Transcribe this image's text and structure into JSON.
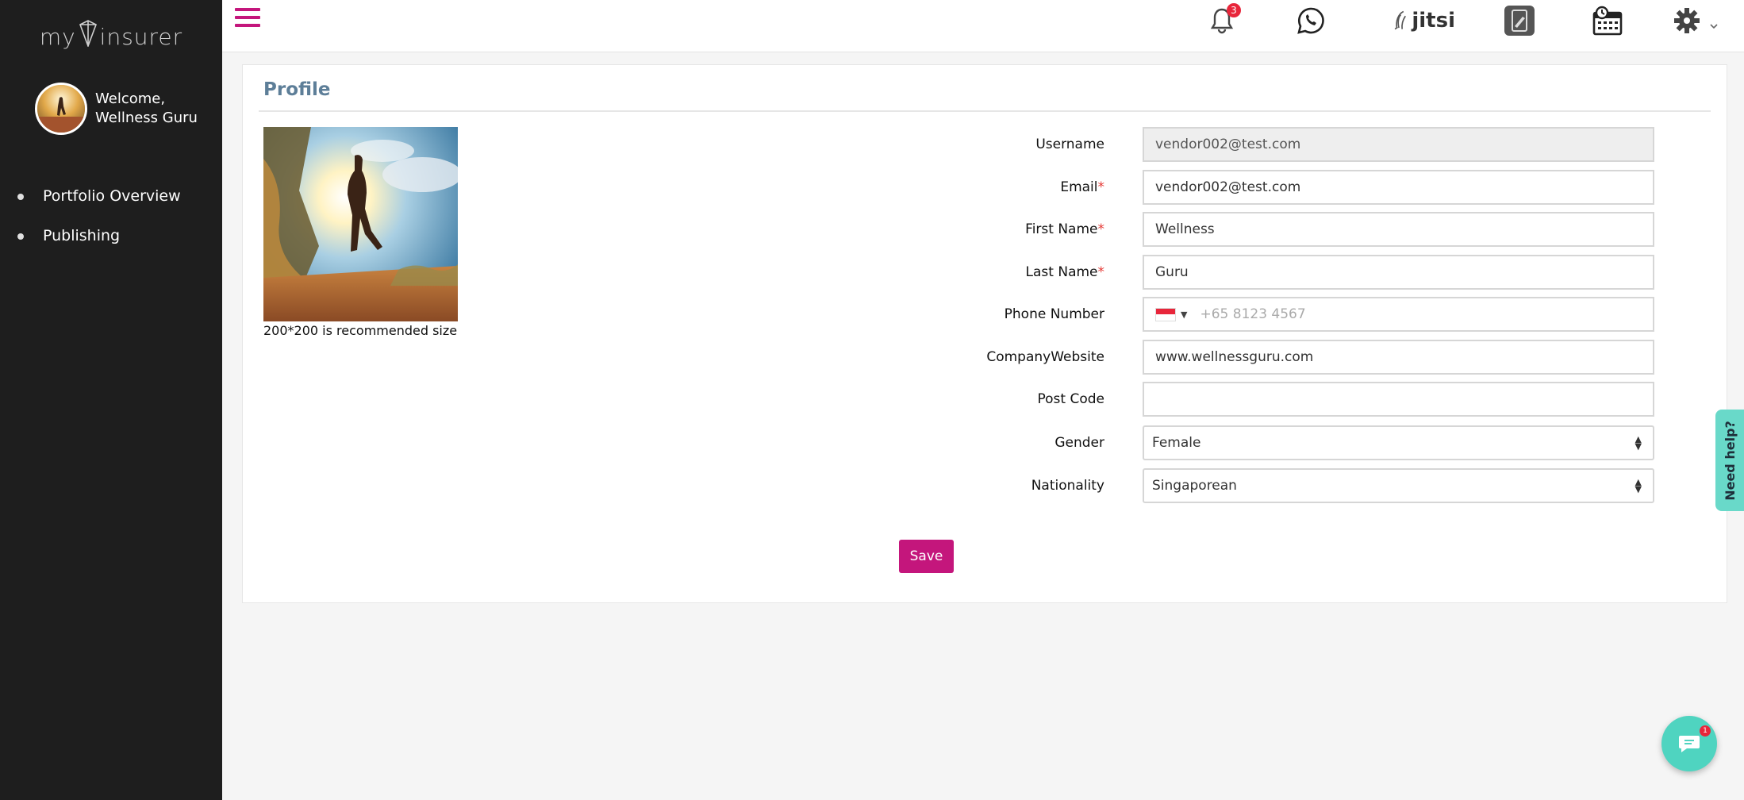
{
  "brand": {
    "logo_left": "my",
    "logo_right": "insurer"
  },
  "user": {
    "welcome": "Welcome,",
    "name": "Wellness Guru"
  },
  "sidebar": {
    "items": [
      {
        "label": "Portfolio Overview"
      },
      {
        "label": "Publishing"
      }
    ]
  },
  "topbar": {
    "notifications_count": "3",
    "jitsi_label": "jitsi",
    "icons": [
      "menu-icon",
      "bell-icon",
      "whatsapp-icon",
      "jitsi-icon",
      "notes-icon",
      "calendar-icon",
      "gear-icon",
      "chevron-down-icon"
    ]
  },
  "profile": {
    "title": "Profile",
    "photo_hint": "200*200 is recommended size",
    "fields": {
      "username": {
        "label": "Username",
        "value": "vendor002@test.com"
      },
      "email": {
        "label": "Email",
        "value": "vendor002@test.com",
        "required": "*"
      },
      "first_name": {
        "label": "First Name",
        "value": "Wellness",
        "required": "*"
      },
      "last_name": {
        "label": "Last Name",
        "value": "Guru",
        "required": "*"
      },
      "phone": {
        "label": "Phone Number",
        "placeholder": "+65 8123 4567"
      },
      "website": {
        "label": "CompanyWebsite",
        "value": "www.wellnessguru.com"
      },
      "post_code": {
        "label": "Post Code",
        "value": ""
      },
      "gender": {
        "label": "Gender",
        "value": "Female"
      },
      "nationality": {
        "label": "Nationality",
        "value": "Singaporean"
      }
    },
    "save_label": "Save"
  },
  "help": {
    "label": "Need help?"
  },
  "chat": {
    "badge": "1"
  },
  "colors": {
    "accent": "#c4167c",
    "sidebar_bg": "#1e1e1e",
    "help_bg": "#69d9c9",
    "title": "#5d7e98"
  }
}
